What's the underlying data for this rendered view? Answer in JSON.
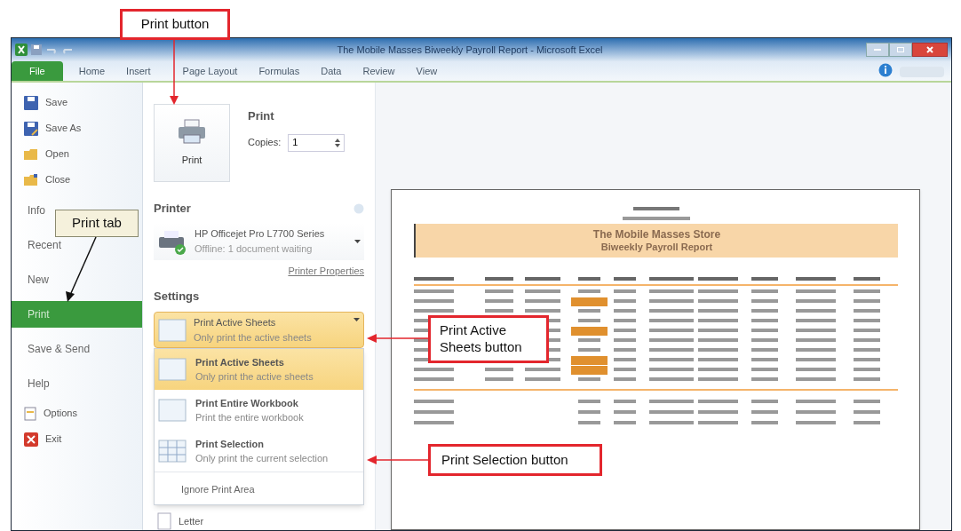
{
  "window": {
    "title": "The Mobile Masses Biweekly Payroll Report - Microsoft Excel"
  },
  "ribbon_tabs": [
    {
      "label": "File",
      "selected": true
    },
    {
      "label": "Home",
      "selected": false
    },
    {
      "label": "Insert",
      "selected": false
    },
    {
      "label": "Page Layout",
      "selected": false
    },
    {
      "label": "Formulas",
      "selected": false
    },
    {
      "label": "Data",
      "selected": false
    },
    {
      "label": "Review",
      "selected": false
    },
    {
      "label": "View",
      "selected": false
    }
  ],
  "nav": [
    {
      "label": "Save",
      "kind": "command",
      "selected": false
    },
    {
      "label": "Save As",
      "kind": "command",
      "selected": false
    },
    {
      "label": "Open",
      "kind": "command",
      "selected": false
    },
    {
      "label": "Close",
      "kind": "command",
      "selected": false
    },
    {
      "label": "Info",
      "kind": "tab",
      "selected": false
    },
    {
      "label": "Recent",
      "kind": "tab",
      "selected": false
    },
    {
      "label": "New",
      "kind": "tab",
      "selected": false
    },
    {
      "label": "Print",
      "kind": "tab",
      "selected": true
    },
    {
      "label": "Save & Send",
      "kind": "tab",
      "selected": false
    },
    {
      "label": "Help",
      "kind": "tab",
      "selected": false
    },
    {
      "label": "Options",
      "kind": "command",
      "selected": false
    },
    {
      "label": "Exit",
      "kind": "command",
      "selected": false
    }
  ],
  "print": {
    "button_label": "Print",
    "heading": "Print",
    "copies_label": "Copies:",
    "copies_value": "1"
  },
  "printer": {
    "heading": "Printer",
    "name": "HP Officejet Pro L7700 Series",
    "status": "Offline: 1 document waiting",
    "properties_link": "Printer Properties"
  },
  "settings": {
    "heading": "Settings",
    "dropdown": {
      "title": "Print Active Sheets",
      "subtitle": "Only print the active sheets"
    },
    "menu": [
      {
        "title": "Print Active Sheets",
        "subtitle": "Only print the active sheets",
        "selected": true
      },
      {
        "title": "Print Entire Workbook",
        "subtitle": "Print the entire workbook",
        "selected": false
      },
      {
        "title": "Print Selection",
        "subtitle": "Only print the current selection",
        "selected": false
      }
    ],
    "ignore_print_area": "Ignore Print Area",
    "paper": "Letter"
  },
  "preview": {
    "title": "The Mobile Masses Store",
    "subtitle": "Biweekly Payroll Report"
  },
  "callouts": [
    {
      "text": "Print button"
    },
    {
      "text": "Print tab"
    },
    {
      "text": "Print Active Sheets button"
    },
    {
      "text": "Print Selection button"
    }
  ]
}
